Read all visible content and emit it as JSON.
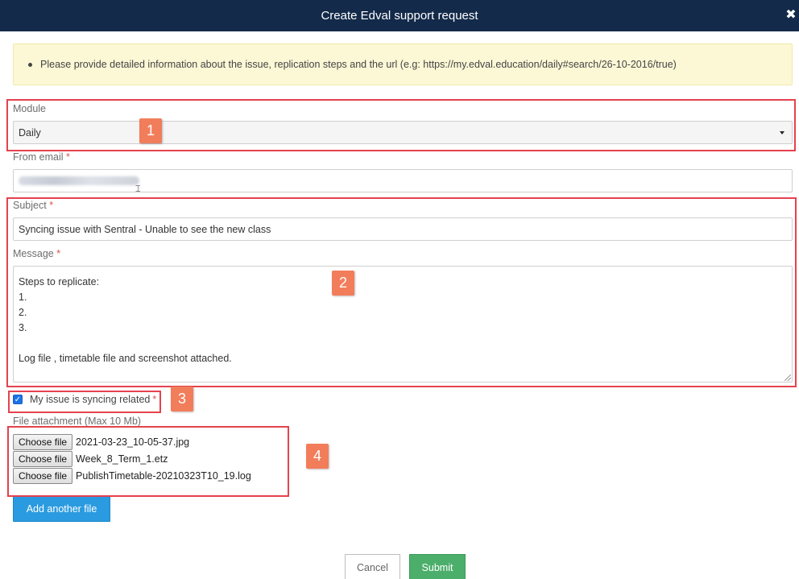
{
  "dialog": {
    "title": "Create Edval support request",
    "close_icon": "close-icon"
  },
  "alert": {
    "text": "Please provide detailed information about the issue, replication steps and the url (e.g: https://my.edval.education/daily#search/26-10-2016/true)"
  },
  "form": {
    "module": {
      "label": "Module",
      "value": "Daily"
    },
    "from_email": {
      "label": "From email",
      "required": "*"
    },
    "subject": {
      "label": "Subject",
      "required": "*",
      "value": "Syncing issue with Sentral - Unable to see the new class"
    },
    "message": {
      "label": "Message",
      "required": "*",
      "value": "Steps to replicate:\n1.\n2.\n3.\n\nLog file , timetable file and screenshot attached."
    },
    "syncing_checkbox": {
      "label": "My issue is syncing related",
      "required": "*",
      "checked": true
    },
    "attachments": {
      "label": "File attachment (Max 10 Mb)",
      "choose_label": "Choose file",
      "files": [
        "2021-03-23_10-05-37.jpg",
        "Week_8_Term_1.etz",
        "PublishTimetable-20210323T10_19.log"
      ]
    },
    "add_file_label": "Add another file"
  },
  "footer": {
    "cancel_label": "Cancel",
    "submit_label": "Submit"
  },
  "annotations": {
    "badges": [
      "1",
      "2",
      "3",
      "4"
    ],
    "color": "#e5424d",
    "badge_color": "#f27d5b"
  }
}
